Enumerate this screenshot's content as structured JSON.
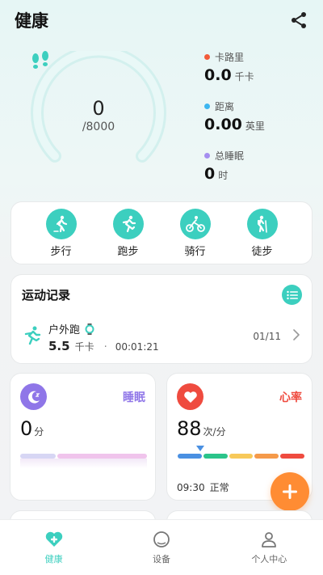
{
  "header": {
    "title": "健康"
  },
  "steps": {
    "value": "0",
    "goal": "/8000",
    "progress": 0
  },
  "metrics": [
    {
      "label": "卡路里",
      "value": "0.0",
      "unit": "千卡",
      "color": "#f25b3a"
    },
    {
      "label": "距离",
      "value": "0.00",
      "unit": "英里",
      "color": "#3cb6f0"
    },
    {
      "label": "总睡眠",
      "value": "0",
      "unit": "时",
      "color": "#a58ef0"
    }
  ],
  "sports": [
    {
      "label": "步行",
      "icon": "walk-icon"
    },
    {
      "label": "跑步",
      "icon": "run-icon"
    },
    {
      "label": "骑行",
      "icon": "bike-icon"
    },
    {
      "label": "徒步",
      "icon": "hike-icon"
    }
  ],
  "records": {
    "title": "运动记录",
    "item": {
      "name": "户外跑",
      "distance": "5.5",
      "unit": "千卡",
      "separator": "·",
      "duration": "00:01:21",
      "date": "01/11"
    }
  },
  "sleep": {
    "name": "睡眠",
    "value": "0",
    "unit": "分",
    "color": "#8f76e8"
  },
  "heart_rate": {
    "name": "心率",
    "value": "88",
    "unit": "次/分",
    "time": "09:30",
    "status": "正常",
    "color": "#ef4b3f"
  },
  "tabs": [
    {
      "label": "健康",
      "active": true
    },
    {
      "label": "设备",
      "active": false
    },
    {
      "label": "个人中心",
      "active": false
    }
  ],
  "colors": {
    "accent": "#3ccfbf",
    "fab": "#ff8c33"
  }
}
